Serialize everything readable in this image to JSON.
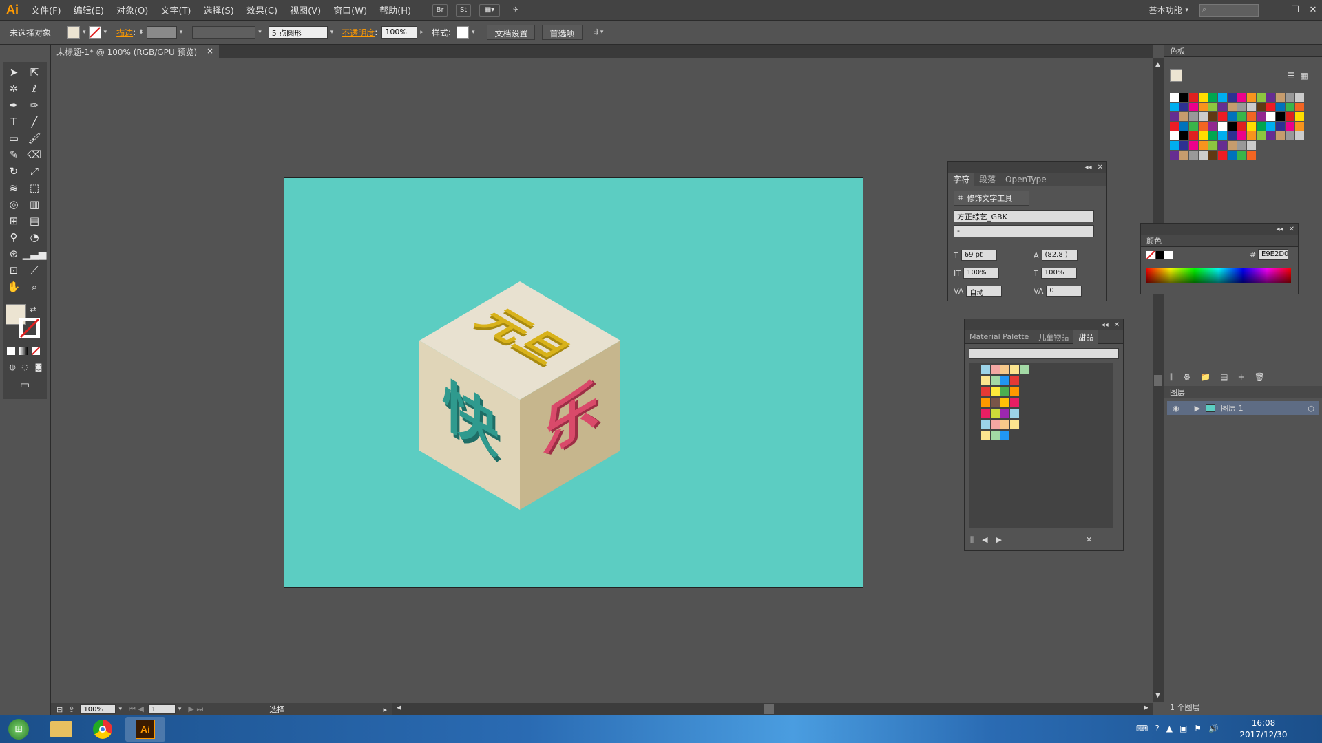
{
  "app": {
    "logo": "Ai"
  },
  "menu": [
    "文件(F)",
    "编辑(E)",
    "对象(O)",
    "文字(T)",
    "选择(S)",
    "效果(C)",
    "视图(V)",
    "窗口(W)",
    "帮助(H)"
  ],
  "menu_buttons": [
    "Br",
    "St"
  ],
  "workspace": "基本功能",
  "controlbar": {
    "selection": "未选择对象",
    "stroke_label": "描边",
    "brush": "5 点圆形",
    "opacity_label": "不透明度",
    "opacity_value": "100%",
    "style_label": "样式",
    "doc_setup": "文档设置",
    "prefs": "首选项"
  },
  "document_tab": {
    "title": "未标题-1* @ 100% (RGB/GPU 预览)",
    "close": "×"
  },
  "artwork": {
    "top_text": "元旦",
    "left_text": "快",
    "right_text": "乐"
  },
  "colors": {
    "artboard": "#5ccdc2",
    "cube_top": "#e8e1d0",
    "cube_left": "#e0d5b8",
    "cube_right": "#c6b68d",
    "gold": "#d8b21a",
    "teal": "#2f9a8e",
    "pink": "#d94a6a"
  },
  "char_panel": {
    "tabs": [
      "字符",
      "段落",
      "OpenType"
    ],
    "touch_tool": "修饰文字工具",
    "font": "方正综艺_GBK",
    "style": "-",
    "size": "69 pt",
    "leading": "(82.8 )",
    "vscale": "100%",
    "hscale": "100%",
    "kerning": "自动",
    "tracking": "0"
  },
  "swatch_lib_panel": {
    "tabs": [
      "Material Palette",
      "儿童物品",
      "甜品"
    ]
  },
  "swatches_panel": {
    "title": "色板"
  },
  "color_panel": {
    "title": "颜色",
    "hex": "E9E2D0"
  },
  "layers_panel": {
    "title": "图层",
    "layer": "图层 1",
    "count": "1 个图层"
  },
  "status": {
    "zoom": "100%",
    "page": "1",
    "tool": "选择"
  },
  "taskbar": {
    "time": "16:08",
    "date": "2017/12/30"
  }
}
